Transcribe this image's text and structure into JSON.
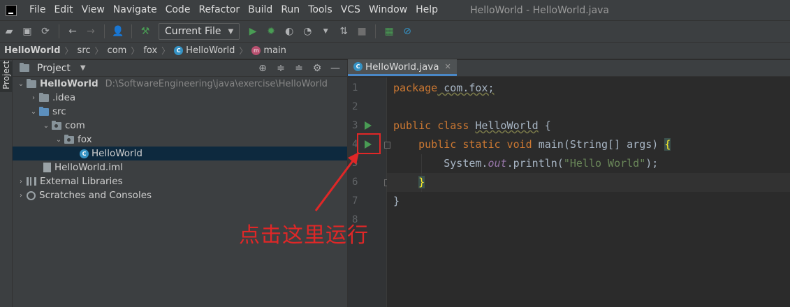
{
  "menu": {
    "items": [
      "File",
      "Edit",
      "View",
      "Navigate",
      "Code",
      "Refactor",
      "Build",
      "Run",
      "Tools",
      "VCS",
      "Window",
      "Help"
    ],
    "window_title": "HelloWorld - HelloWorld.java"
  },
  "toolbar": {
    "run_config": "Current File"
  },
  "breadcrumb": {
    "project": "HelloWorld",
    "src": "src",
    "com": "com",
    "fox": "fox",
    "class": "HelloWorld",
    "method": "main"
  },
  "side_stripe": {
    "tab": "Project"
  },
  "project_panel": {
    "title": "Project",
    "tree": {
      "root": "HelloWorld",
      "root_path": "D:\\SoftwareEngineering\\java\\exercise\\HelloWorld",
      "idea": ".idea",
      "src": "src",
      "com": "com",
      "fox": "fox",
      "class_file": "HelloWorld",
      "iml": "HelloWorld.iml",
      "external_libraries": "External Libraries",
      "scratches": "Scratches and Consoles"
    }
  },
  "editor": {
    "tab_label": "HelloWorld.java",
    "line_numbers": [
      "1",
      "2",
      "3",
      "4",
      "5",
      "6",
      "7",
      "8"
    ],
    "code": {
      "l1_kw": "package",
      "l1_rest": " com.fox;",
      "l3_kw": "public class",
      "l3_name": "HelloWorld",
      "l3_rest": " {",
      "l4_kw": "public static void",
      "l4_rest": " main(String[] args) ",
      "l4_brace": "{",
      "l5_a": "System.",
      "l5_field": "out",
      "l5_b": ".println(",
      "l5_str": "\"Hello World\"",
      "l5_c": ");",
      "l6_brace": "}",
      "l7": "}"
    }
  },
  "annotation": {
    "text": "点击这里运行",
    "color": "#e02727"
  }
}
